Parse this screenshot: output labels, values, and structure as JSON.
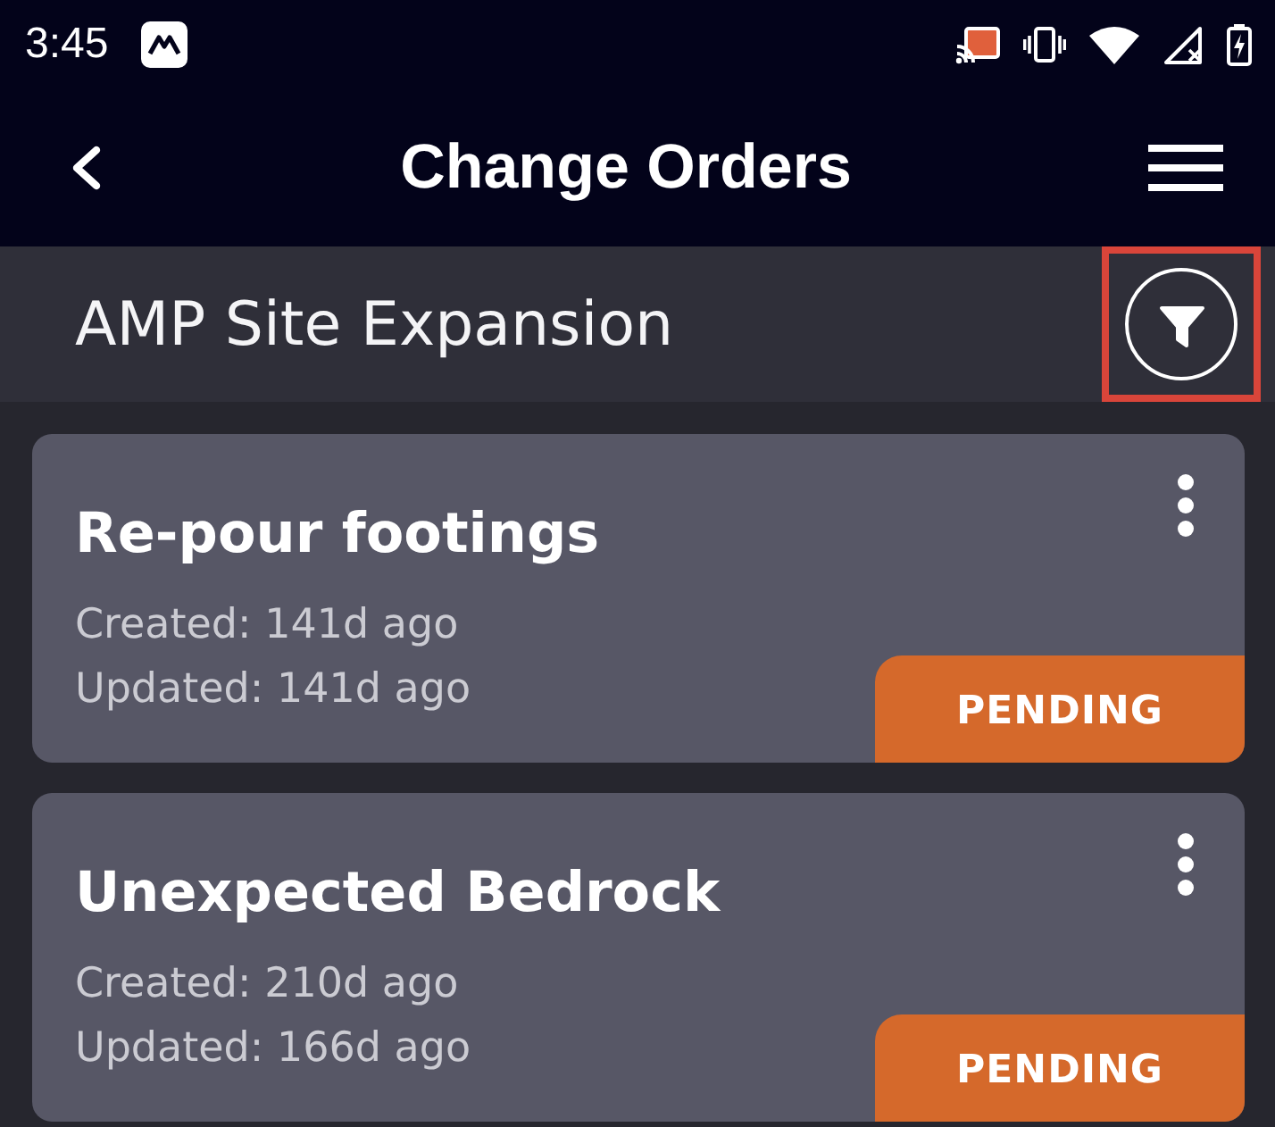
{
  "status_bar": {
    "time": "3:45"
  },
  "app_bar": {
    "title": "Change Orders"
  },
  "project": {
    "name": "AMP Site Expansion",
    "filter_button": {
      "highlighted": true
    }
  },
  "orders": [
    {
      "title": "Re-pour footings",
      "created": "Created: 141d ago",
      "updated": "Updated: 141d ago",
      "status": "PENDING"
    },
    {
      "title": "Unexpected Bedrock",
      "created": "Created: 210d ago",
      "updated": "Updated: 166d ago",
      "status": "PENDING"
    }
  ]
}
